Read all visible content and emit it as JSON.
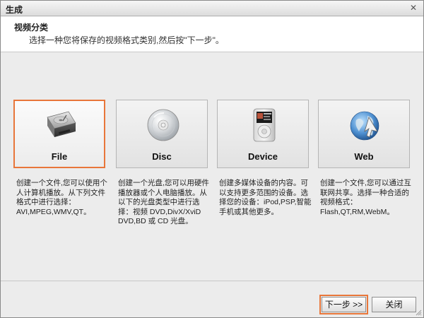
{
  "window": {
    "title": "生成",
    "close_glyph": "✕"
  },
  "header": {
    "title": "视频分类",
    "subtitle": "选择一种您将保存的视频格式类别,然后按\"下一步\"。"
  },
  "cards": [
    {
      "label": "File",
      "icon": "hard-drive-icon",
      "selected": true,
      "description": "创建一个文件,您可以使用个人计算机播放。从下列文件格式中进行选择：AVI,MPEG,WMV,QT。"
    },
    {
      "label": "Disc",
      "icon": "optical-disc-icon",
      "selected": false,
      "description": "创建一个光盘,您可以用硬件播放器或个人电脑播放。从以下的光盘类型中进行选择：视频 DVD,DivX/XviD DVD,BD 或 CD 光盘。"
    },
    {
      "label": "Device",
      "icon": "media-player-icon",
      "selected": false,
      "description": "创建多媒体设备的内容。可以支持更多范围的设备。选择您的设备：iPod,PSP,智能手机或其他更多。"
    },
    {
      "label": "Web",
      "icon": "globe-icon",
      "selected": false,
      "description": "创建一个文件,您可以通过互联网共享。选择一种合适的视频格式：Flash,QT,RM,WebM。"
    }
  ],
  "footer": {
    "next_label": "下一步 >>",
    "close_label": "关闭"
  },
  "colors": {
    "selection": "#e8763a",
    "header_bg": "#ffffff",
    "window_bg": "#ececec"
  }
}
